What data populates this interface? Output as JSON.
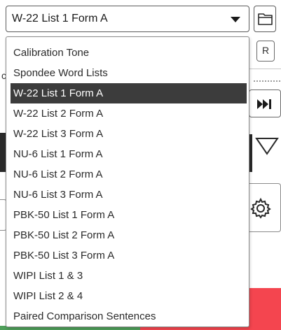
{
  "combo": {
    "selected": "W-22 List 1 Form A"
  },
  "background": {
    "r_button_label": "R",
    "left_fragment_char": "c"
  },
  "dropdown": {
    "items": [
      {
        "label": "Calibration Tone"
      },
      {
        "label": "Spondee Word Lists"
      },
      {
        "label": "W-22 List 1 Form A",
        "selected": true
      },
      {
        "label": "W-22 List 2 Form A"
      },
      {
        "label": "W-22 List 3 Form A"
      },
      {
        "label": "NU-6 List 1 Form A"
      },
      {
        "label": "NU-6 List 2 Form A"
      },
      {
        "label": "NU-6 List 3 Form A"
      },
      {
        "label": "PBK-50 List 1 Form A"
      },
      {
        "label": "PBK-50 List 2 Form A"
      },
      {
        "label": "PBK-50 List 3 Form A"
      },
      {
        "label": "WIPI List 1 & 3"
      },
      {
        "label": "WIPI List 2 & 4"
      },
      {
        "label": "Paired Comparison Sentences"
      }
    ]
  },
  "icons": {
    "folder": "folder-icon",
    "dropdown_arrow": "chevron-down-icon",
    "next": "skip-next-icon",
    "triangle": "triangle-down-icon",
    "settings": "gear-icon"
  },
  "colors": {
    "selected_bg": "#3c3c3c",
    "selected_text": "#ffffff",
    "stop_red": "#f4454f",
    "go_green": "#4f9f5a"
  }
}
